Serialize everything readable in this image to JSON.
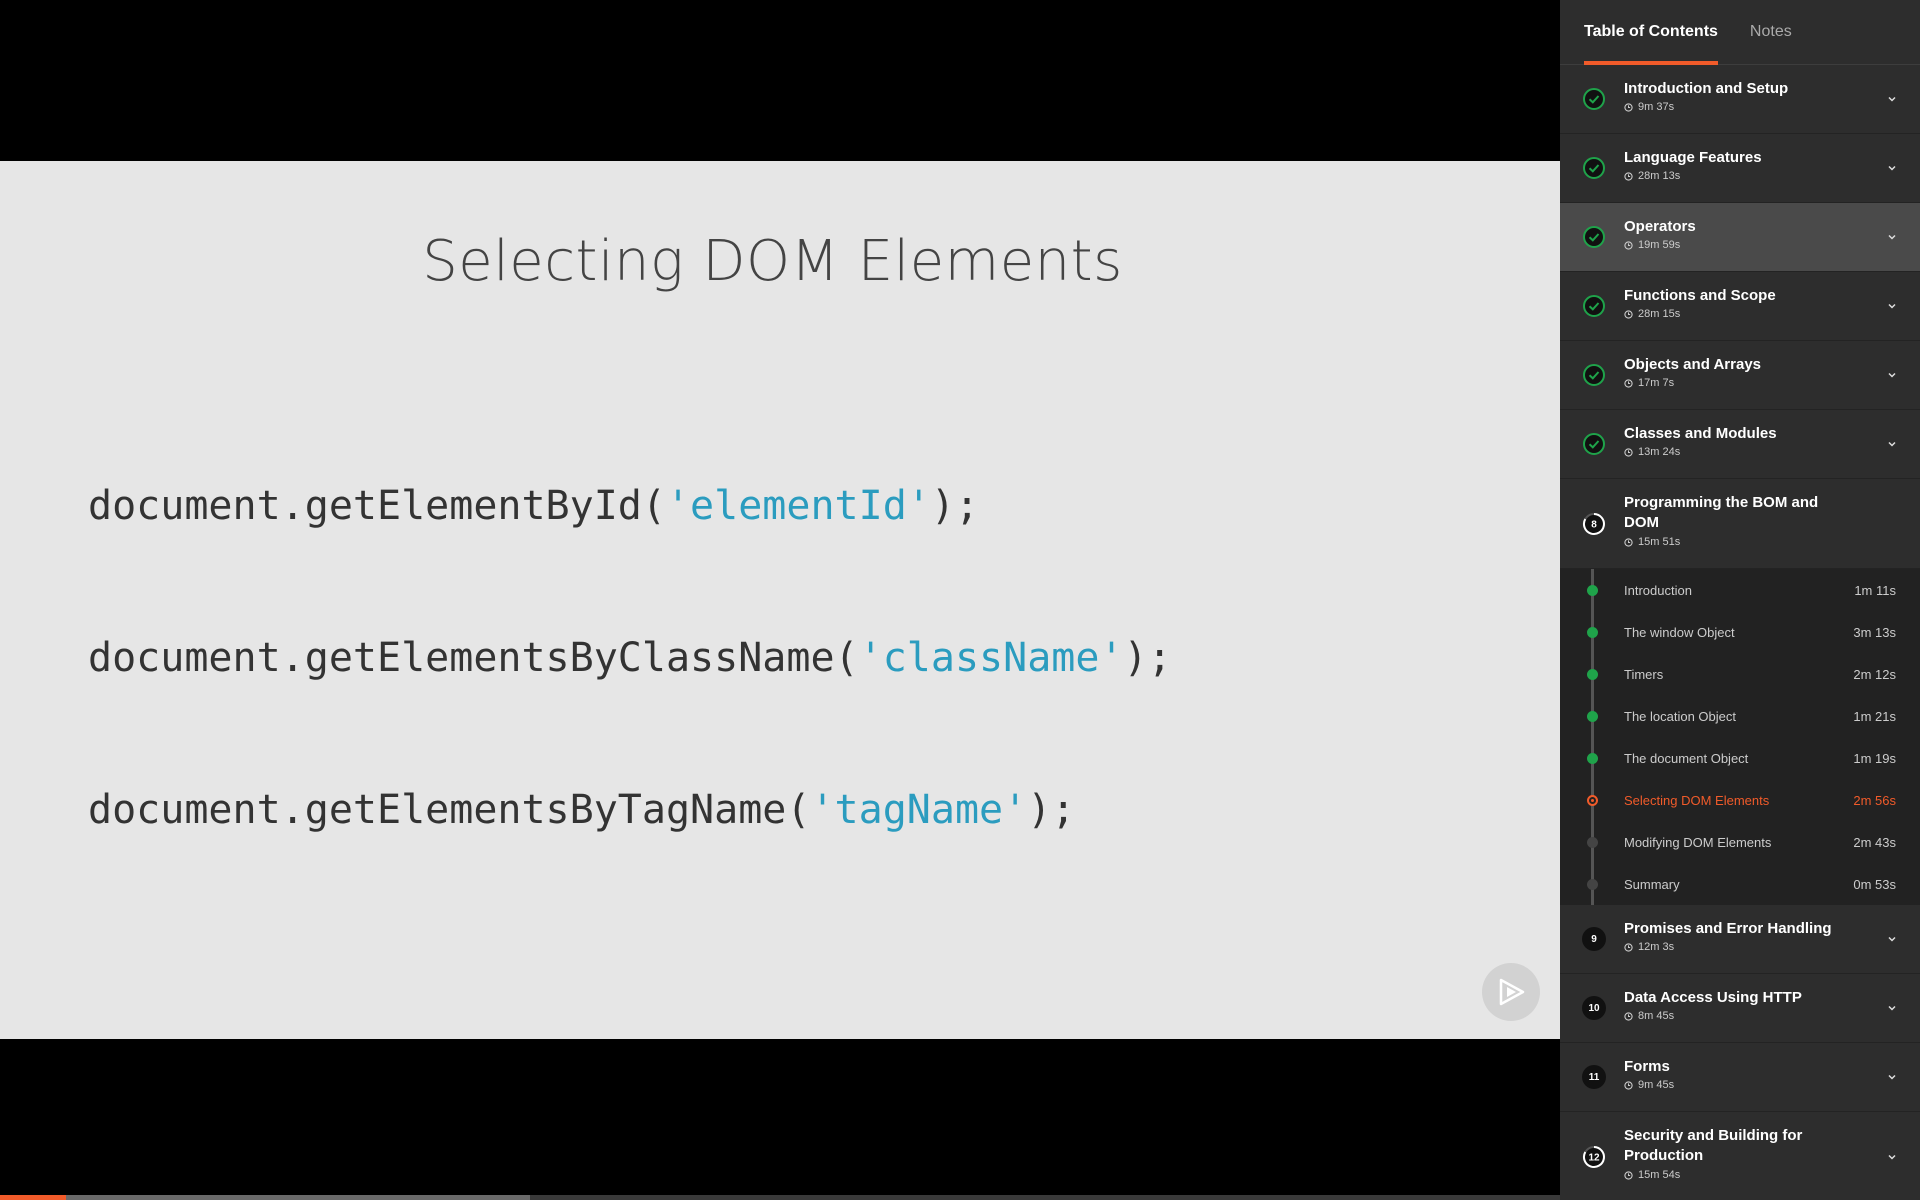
{
  "slide": {
    "title": "Selecting DOM Elements",
    "code": [
      {
        "pre": "document.getElementById(",
        "str": "'elementId'",
        "post": ");"
      },
      {
        "pre": "document.getElementsByClassName(",
        "str": "'className'",
        "post": ");"
      },
      {
        "pre": "document.getElementsByTagName(",
        "str": "'tagName'",
        "post": ");"
      }
    ]
  },
  "player": {
    "progress_fraction": 0.042,
    "buffer_fraction": 0.34,
    "logo_icon": "play-logo-icon"
  },
  "sidebar": {
    "tabs": [
      {
        "label": "Table of Contents",
        "active": true
      },
      {
        "label": "Notes",
        "active": false
      }
    ],
    "modules": [
      {
        "title": "Introduction and Setup",
        "duration": "9m 37s",
        "status": "complete"
      },
      {
        "title": "Language Features",
        "duration": "28m 13s",
        "status": "complete"
      },
      {
        "title": "Operators",
        "duration": "19m 59s",
        "status": "complete",
        "highlight": true
      },
      {
        "title": "Functions and Scope",
        "duration": "28m 15s",
        "status": "complete"
      },
      {
        "title": "Objects and Arrays",
        "duration": "17m 7s",
        "status": "complete"
      },
      {
        "title": "Classes and Modules",
        "duration": "13m 24s",
        "status": "complete"
      },
      {
        "title": "Programming the BOM and DOM",
        "duration": "15m 51s",
        "status": "in-progress",
        "number": "8"
      },
      {
        "title": "Promises and Error Handling",
        "duration": "12m 3s",
        "status": "not-started",
        "number": "9"
      },
      {
        "title": "Data Access Using HTTP",
        "duration": "8m 45s",
        "status": "not-started",
        "number": "10"
      },
      {
        "title": "Forms",
        "duration": "9m 45s",
        "status": "not-started",
        "number": "11"
      },
      {
        "title": "Security and Building for Production",
        "duration": "15m 54s",
        "status": "in-progress",
        "number": "12"
      }
    ],
    "clips": [
      {
        "title": "Introduction",
        "time": "1m 11s",
        "status": "done"
      },
      {
        "title": "The window Object",
        "time": "3m 13s",
        "status": "done"
      },
      {
        "title": "Timers",
        "time": "2m 12s",
        "status": "done"
      },
      {
        "title": "The location Object",
        "time": "1m 21s",
        "status": "done"
      },
      {
        "title": "The document Object",
        "time": "1m 19s",
        "status": "done"
      },
      {
        "title": "Selecting DOM Elements",
        "time": "2m 56s",
        "status": "current"
      },
      {
        "title": "Modifying DOM Elements",
        "time": "2m 43s",
        "status": "todo"
      },
      {
        "title": "Summary",
        "time": "0m 53s",
        "status": "todo"
      }
    ],
    "colors": {
      "accent": "#f15b2a",
      "complete": "#1fa34a",
      "code_string": "#2b9cbf"
    }
  }
}
